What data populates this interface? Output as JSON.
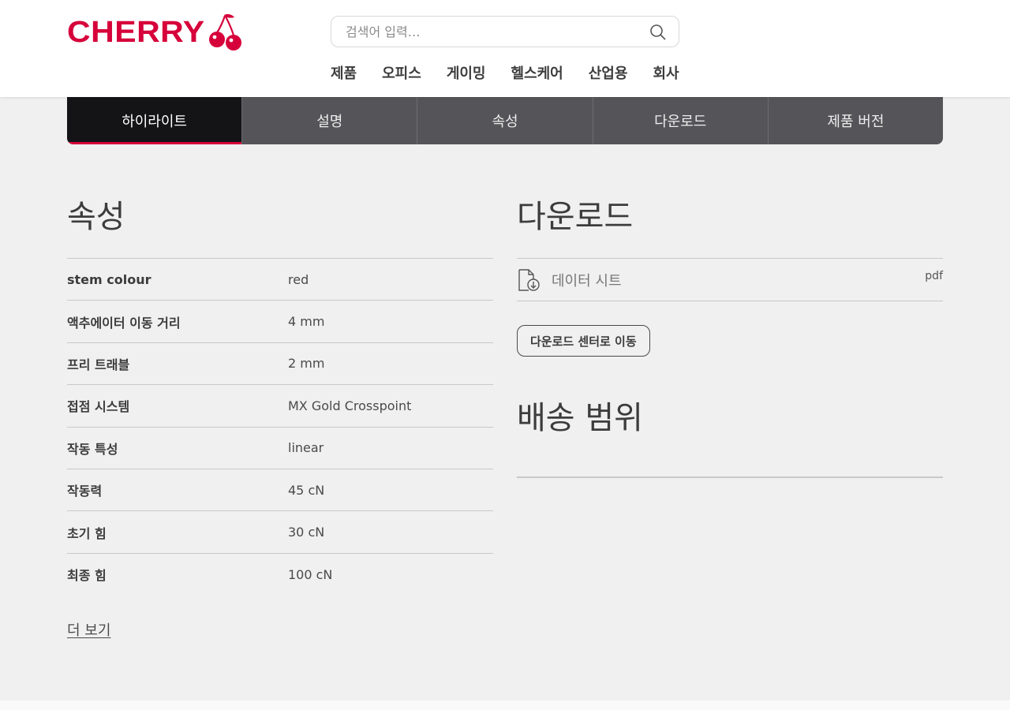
{
  "brand": {
    "logo_text": "CHERRY",
    "accent_color": "#d6003a"
  },
  "search": {
    "placeholder": "검색어 입력…",
    "icon": "search-icon"
  },
  "nav": {
    "items": [
      "제품",
      "오피스",
      "게이밍",
      "헬스케어",
      "산업용",
      "회사"
    ]
  },
  "tabs": {
    "active": "하이라이트",
    "items": [
      "하이라이트",
      "설명",
      "속성",
      "다운로드",
      "제품 버전"
    ]
  },
  "attributes": {
    "title": "속성",
    "rows": [
      {
        "key": "stem colour",
        "value": "red"
      },
      {
        "key": "액추에이터 이동 거리",
        "value": "4 mm"
      },
      {
        "key": "프리 트래블",
        "value": "2 mm"
      },
      {
        "key": "접점 시스템",
        "value": "MX Gold Crosspoint"
      },
      {
        "key": "작동 특성",
        "value": "linear"
      },
      {
        "key": "작동력",
        "value": "45 cN"
      },
      {
        "key": "초기 힘",
        "value": "30 cN"
      },
      {
        "key": "최종 힘",
        "value": "100 cN"
      }
    ],
    "more_label": "더 보기"
  },
  "downloads": {
    "title": "다운로드",
    "items": [
      {
        "label": "데이터 시트",
        "type": "pdf",
        "icon": "file-download-icon"
      }
    ],
    "center_button": "다운로드 센터로 이동"
  },
  "scope": {
    "title": "배송 범위"
  }
}
